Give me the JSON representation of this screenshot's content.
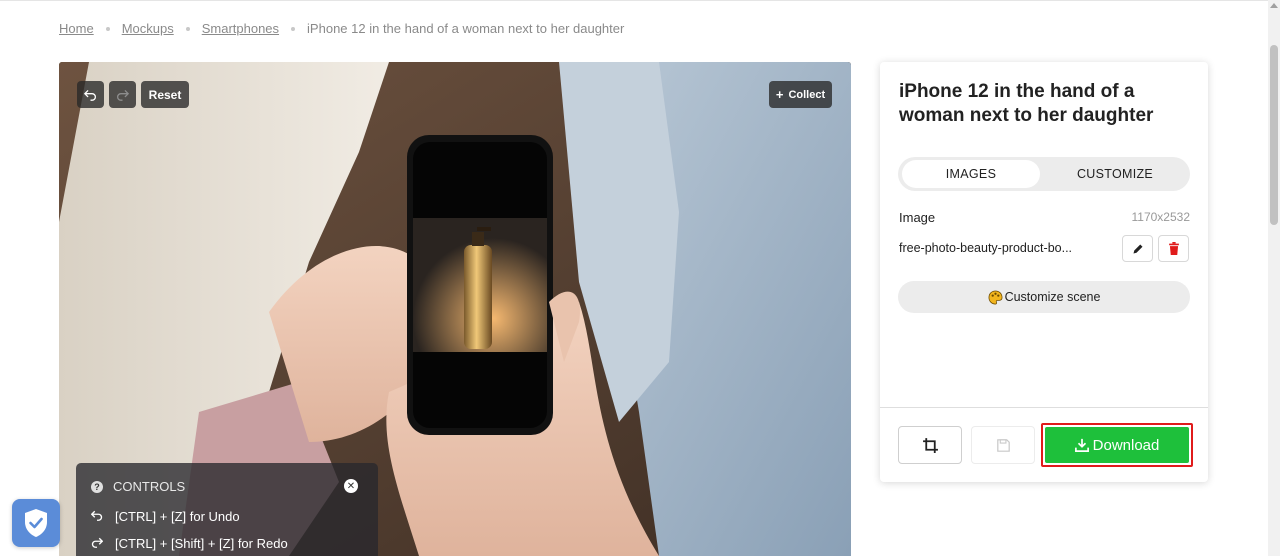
{
  "breadcrumb": {
    "items": [
      "Home",
      "Mockups",
      "Smartphones"
    ],
    "current": "iPhone 12 in the hand of a woman next to her daughter"
  },
  "toolbar": {
    "reset_label": "Reset",
    "collect_label": "Collect",
    "undo_icon": "undo-icon",
    "redo_icon": "redo-icon"
  },
  "controls": {
    "title": "CONTROLS",
    "undo_hint": "[CTRL] + [Z] for Undo",
    "redo_hint": "[CTRL] + [Shift] + [Z] for Redo"
  },
  "panel": {
    "title": "iPhone 12 in the hand of a woman next to her daughter",
    "tabs": [
      {
        "label": "IMAGES",
        "active": true
      },
      {
        "label": "CUSTOMIZE",
        "active": false
      }
    ],
    "image_label": "Image",
    "image_dims": "1170x2532",
    "file_name": "free-photo-beauty-product-bo...",
    "customize_scene_label": "Customize scene",
    "download_label": "Download"
  },
  "colors": {
    "download": "#1ec03b",
    "highlight": "#e01b1b",
    "shield": "#5b8cd8"
  }
}
